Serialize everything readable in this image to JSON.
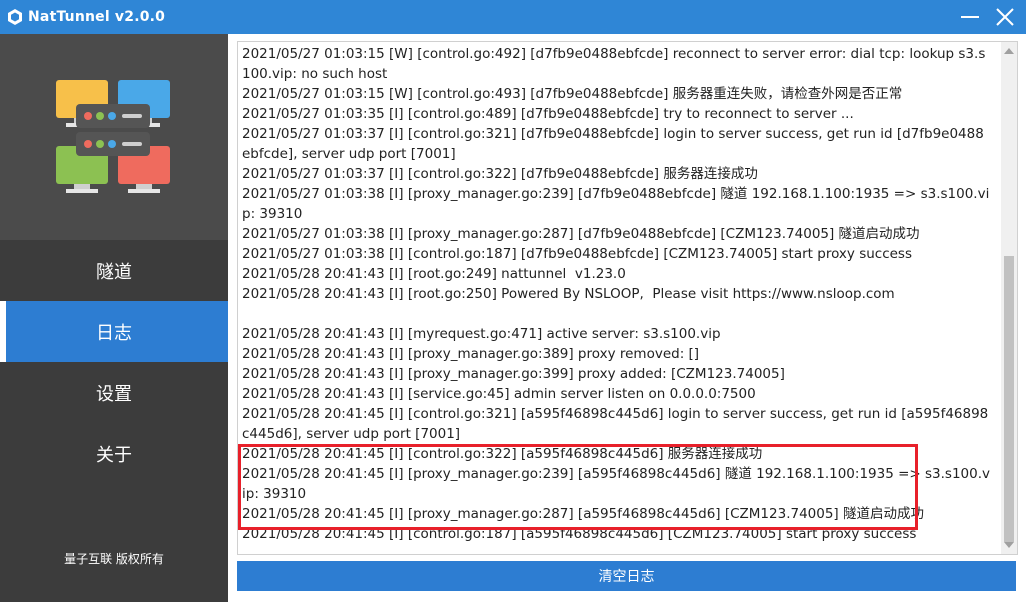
{
  "window": {
    "title": "NatTunnel v2.0.0"
  },
  "sidebar": {
    "nav_items": [
      {
        "label": "隧道"
      },
      {
        "label": "日志"
      },
      {
        "label": "设置"
      },
      {
        "label": "关于"
      }
    ],
    "active_index": 1,
    "copyright": "量子互联 版权所有"
  },
  "log": {
    "lines": [
      "2021/05/27 01:03:15 [W] [control.go:492] [d7fb9e0488ebfcde] reconnect to server error: dial tcp: lookup s3.s100.vip: no such host",
      "2021/05/27 01:03:15 [W] [control.go:493] [d7fb9e0488ebfcde] 服务器重连失败，请检查外网是否正常",
      "2021/05/27 01:03:35 [I] [control.go:489] [d7fb9e0488ebfcde] try to reconnect to server ...",
      "2021/05/27 01:03:37 [I] [control.go:321] [d7fb9e0488ebfcde] login to server success, get run id [d7fb9e0488ebfcde], server udp port [7001]",
      "2021/05/27 01:03:37 [I] [control.go:322] [d7fb9e0488ebfcde] 服务器连接成功",
      "2021/05/27 01:03:38 [I] [proxy_manager.go:239] [d7fb9e0488ebfcde] 隧道 192.168.1.100:1935 => s3.s100.vip: 39310",
      "2021/05/27 01:03:38 [I] [proxy_manager.go:287] [d7fb9e0488ebfcde] [CZM123.74005] 隧道启动成功",
      "2021/05/27 01:03:38 [I] [control.go:187] [d7fb9e0488ebfcde] [CZM123.74005] start proxy success",
      "2021/05/28 20:41:43 [I] [root.go:249] nattunnel  v1.23.0",
      "2021/05/28 20:41:43 [I] [root.go:250] Powered By NSLOOP,  Please visit https://www.nsloop.com",
      "",
      "2021/05/28 20:41:43 [I] [myrequest.go:471] active server: s3.s100.vip",
      "2021/05/28 20:41:43 [I] [proxy_manager.go:389] proxy removed: []",
      "2021/05/28 20:41:43 [I] [proxy_manager.go:399] proxy added: [CZM123.74005]",
      "2021/05/28 20:41:43 [I] [service.go:45] admin server listen on 0.0.0.0:7500",
      "2021/05/28 20:41:45 [I] [control.go:321] [a595f46898c445d6] login to server success, get run id [a595f46898c445d6], server udp port [7001]",
      "2021/05/28 20:41:45 [I] [control.go:322] [a595f46898c445d6] 服务器连接成功",
      "2021/05/28 20:41:45 [I] [proxy_manager.go:239] [a595f46898c445d6] 隧道 192.168.1.100:1935 => s3.s100.vip: 39310",
      "2021/05/28 20:41:45 [I] [proxy_manager.go:287] [a595f46898c445d6] [CZM123.74005] 隧道启动成功",
      "2021/05/28 20:41:45 [I] [control.go:187] [a595f46898c445d6] [CZM123.74005] start proxy success"
    ]
  },
  "actions": {
    "clear_log_label": "清空日志"
  },
  "colors": {
    "accent": "#2d7dd2",
    "titlebar": "#2f86d6",
    "sidebar_dark": "#3c3c3c",
    "highlight": "#e8202a"
  }
}
